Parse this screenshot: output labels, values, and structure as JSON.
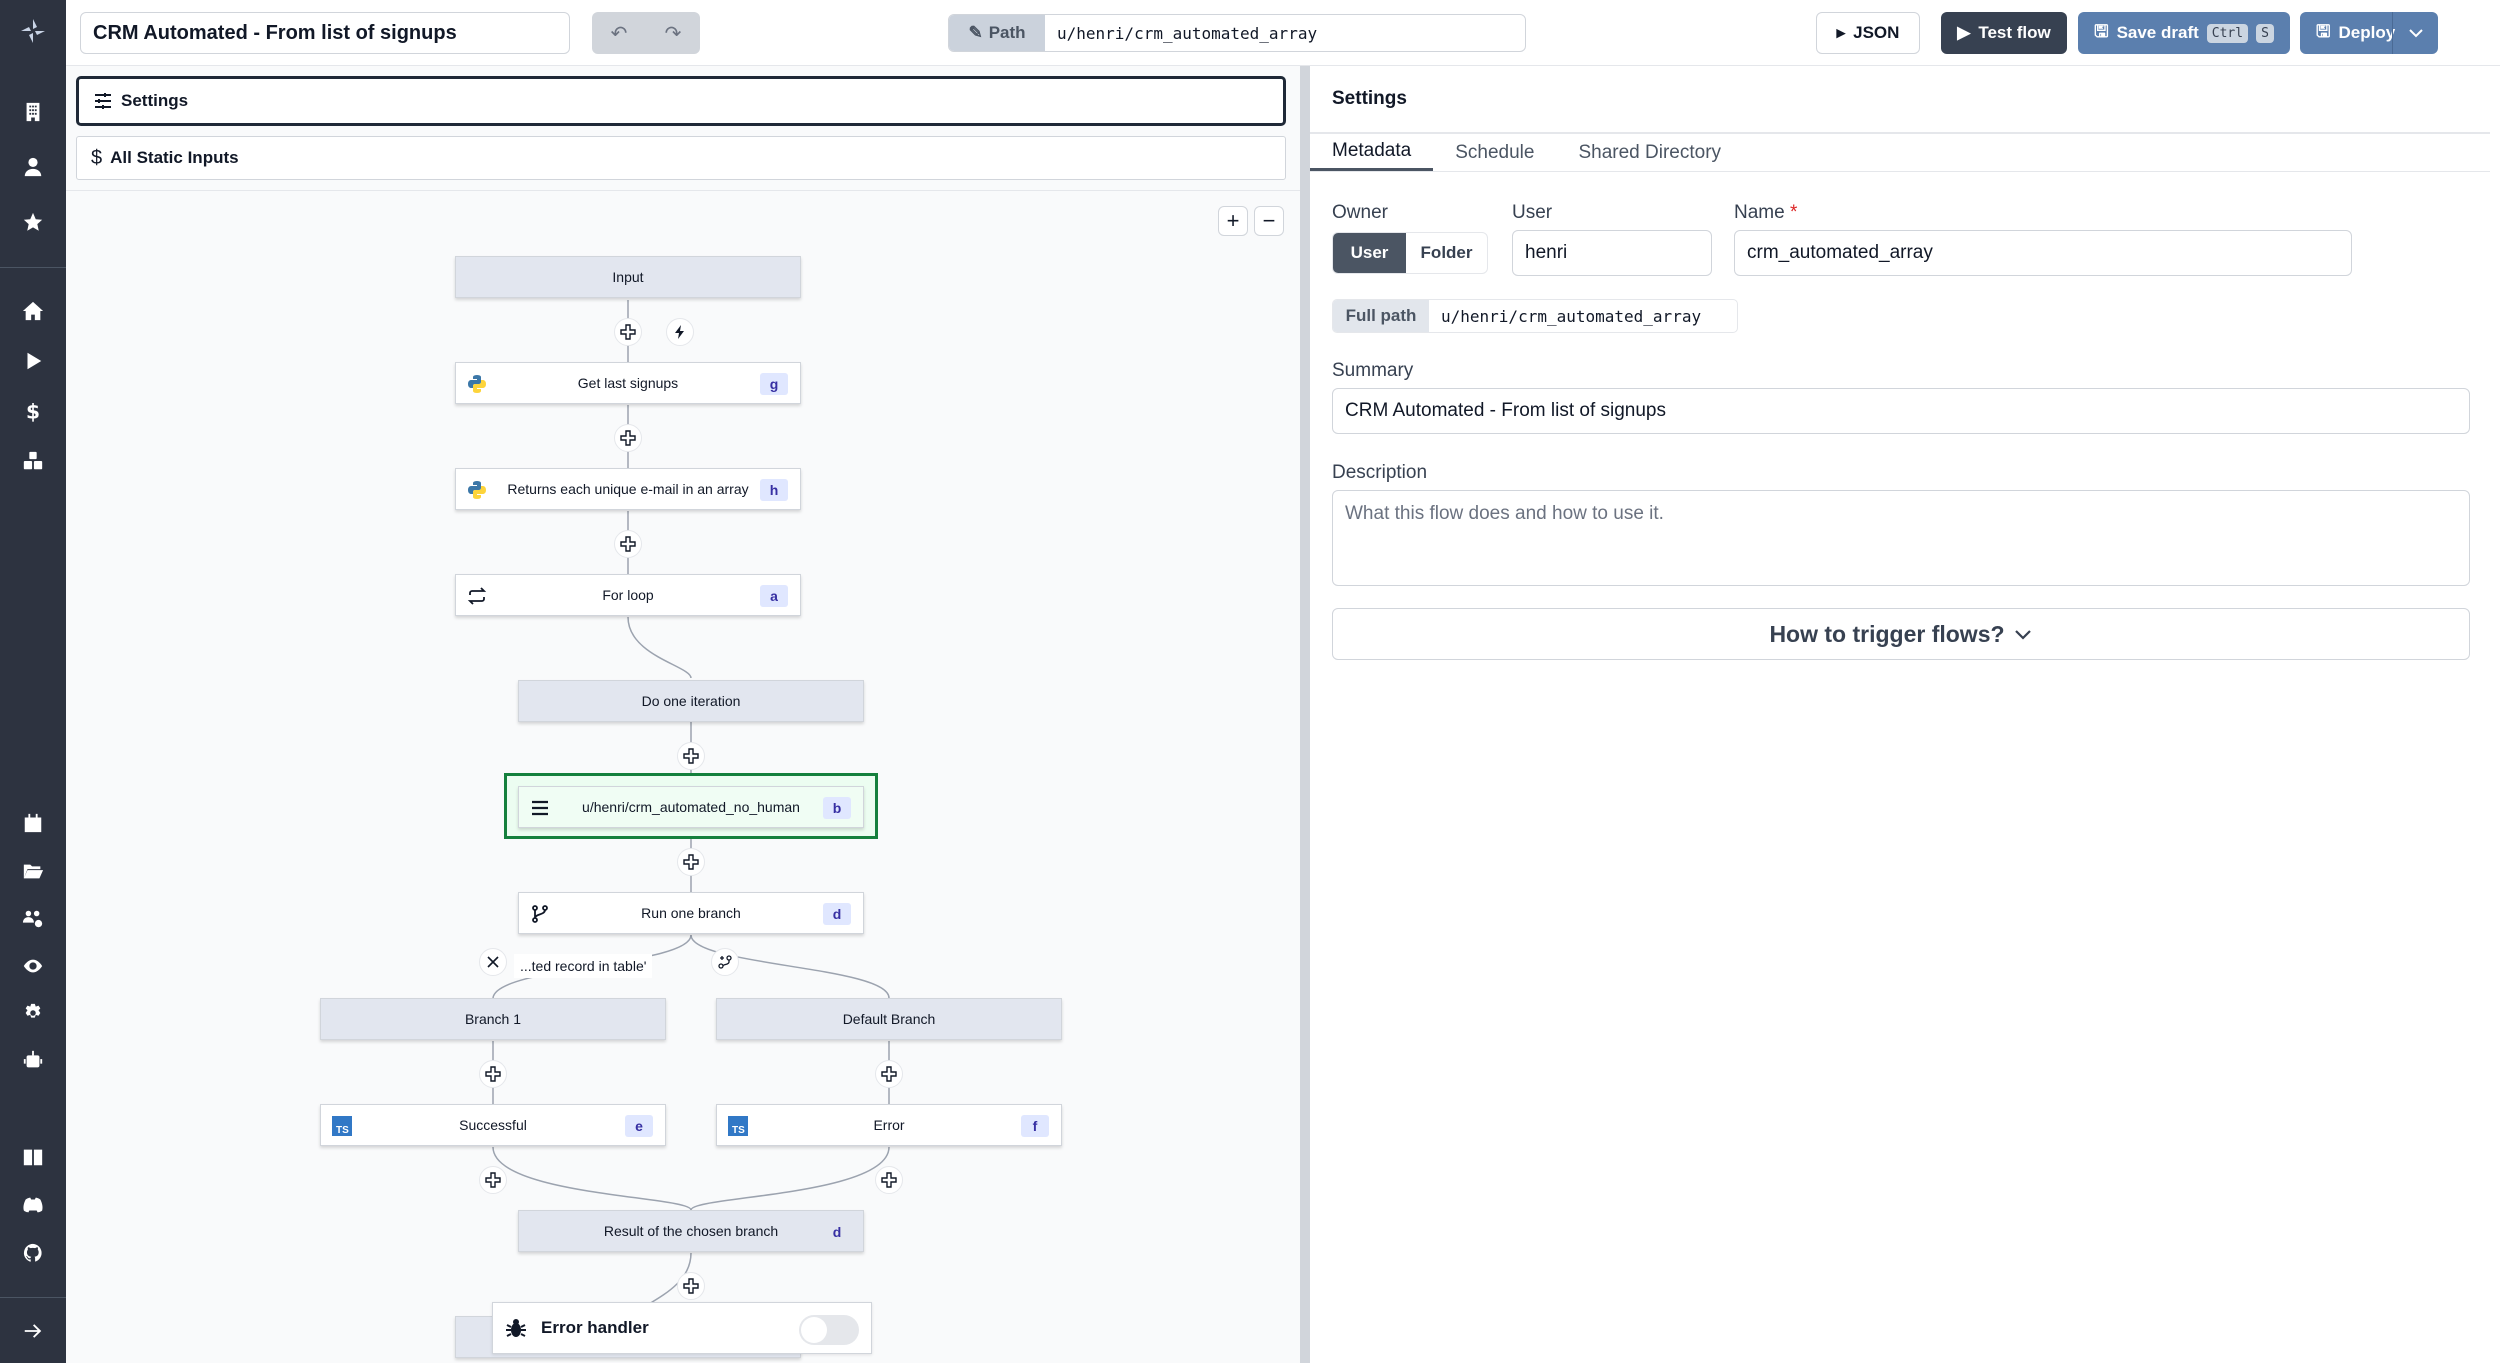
{
  "header": {
    "flow_title": "CRM Automated - From list of signups",
    "undo_icon": "undo-icon",
    "redo_icon": "redo-icon",
    "path_label": "Path",
    "path_value": "u/henri/crm_automated_array",
    "json_label": "JSON",
    "test_flow_label": "Test flow",
    "save_draft_label": "Save draft",
    "save_shortcut": [
      "Ctrl",
      "S"
    ],
    "deploy_label": "Deploy"
  },
  "sidebar": {
    "top_items": [
      {
        "icon": "building-icon",
        "label": "Workspace"
      },
      {
        "icon": "user-icon",
        "label": "User"
      },
      {
        "icon": "star-icon",
        "label": "Favorites"
      }
    ],
    "main_items": [
      {
        "icon": "home-icon",
        "label": "Home"
      },
      {
        "icon": "play-icon",
        "label": "Runs"
      },
      {
        "icon": "dollar-icon",
        "label": "Variables"
      },
      {
        "icon": "cubes-icon",
        "label": "Resources"
      }
    ],
    "bottom_items": [
      {
        "icon": "calendar-icon",
        "label": "Schedules"
      },
      {
        "icon": "folder-icon",
        "label": "Folders"
      },
      {
        "icon": "groups-icon",
        "label": "Groups"
      },
      {
        "icon": "eye-icon",
        "label": "Audit"
      },
      {
        "icon": "gear-icon",
        "label": "Settings"
      },
      {
        "icon": "robot-icon",
        "label": "Workers"
      }
    ],
    "footer_items": [
      {
        "icon": "book-icon",
        "label": "Docs"
      },
      {
        "icon": "discord-icon",
        "label": "Discord"
      },
      {
        "icon": "github-icon",
        "label": "GitHub"
      }
    ],
    "collapse_icon": "arrow-right-icon"
  },
  "flow_panel": {
    "settings_label": "Settings",
    "static_inputs_label": "All Static Inputs",
    "zoom_in": "+",
    "zoom_out": "−"
  },
  "flow_nodes": {
    "input": {
      "label": "Input"
    },
    "get_last_signups": {
      "label": "Get last signups",
      "badge": "g",
      "lang": "python"
    },
    "unique_emails": {
      "label": "Returns each unique e-mail in an array",
      "badge": "h",
      "lang": "python"
    },
    "for_loop": {
      "label": "For loop",
      "badge": "a"
    },
    "do_one_iteration": {
      "label": "Do one iteration"
    },
    "subflow": {
      "label": "u/henri/crm_automated_no_human",
      "badge": "b"
    },
    "run_one_branch": {
      "label": "Run one branch",
      "badge": "d"
    },
    "branch_condition": "...ted record in table'",
    "branch_1": {
      "label": "Branch 1"
    },
    "default_branch": {
      "label": "Default Branch"
    },
    "successful": {
      "label": "Successful",
      "badge": "e",
      "lang": "TS"
    },
    "error": {
      "label": "Error",
      "badge": "f",
      "lang": "TS"
    },
    "result_branch": {
      "label": "Result of the chosen branch",
      "badge": "d"
    }
  },
  "error_handler": {
    "label": "Error handler",
    "enabled": false
  },
  "settings_panel": {
    "title": "Settings",
    "tabs": [
      {
        "label": "Metadata",
        "active": true
      },
      {
        "label": "Schedule",
        "active": false
      },
      {
        "label": "Shared Directory",
        "active": false
      }
    ],
    "owner_label": "Owner",
    "owner_options": [
      "User",
      "Folder"
    ],
    "owner_selected": "User",
    "user_label": "User",
    "user_value": "henri",
    "name_label": "Name",
    "name_required": "*",
    "name_value": "crm_automated_array",
    "full_path_label": "Full path",
    "full_path_value": "u/henri/crm_automated_array",
    "summary_label": "Summary",
    "summary_value": "CRM Automated - From list of signups",
    "description_label": "Description",
    "description_placeholder": "What this flow does and how to use it.",
    "trigger_label": "How to trigger flows?"
  },
  "colors": {
    "sidebar_bg": "#2d3340",
    "primary_btn": "#374151",
    "save_btn": "#5b7fae",
    "selected_border": "#15803d",
    "badge_bg": "#e0e7ff",
    "badge_text": "#3730a3"
  }
}
